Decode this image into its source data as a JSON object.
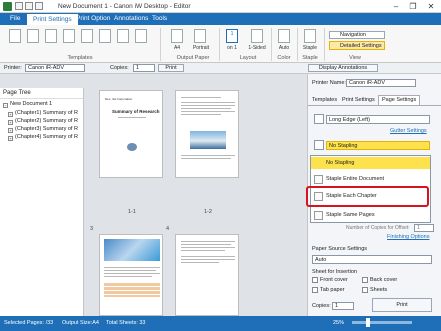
{
  "window": {
    "title": "New Document 1 - Canon iW Desktop - Editor",
    "controls": [
      "–",
      "❐",
      "✕"
    ]
  },
  "ribbon": {
    "tabs": [
      "File",
      "Print Settings",
      "Print Option",
      "Annotations",
      "Tools"
    ],
    "active_tab": "Print Settings",
    "groups": {
      "templates": "Templates",
      "output_paper": "Output Paper",
      "layout": "Layout",
      "color": "Color",
      "staple": "Staple",
      "view": "View"
    },
    "items": {
      "paper_size": "A4",
      "orientation": "Portrait",
      "pages_per_sheet_value": "1",
      "pages_per_sheet_sub": "on 1",
      "sided": "1-Sided",
      "color_mode": "Auto",
      "staple": "Staple",
      "navigation": "Navigation",
      "detailed_settings": "Detailed Settings"
    }
  },
  "toolbar2": {
    "printer_label": "Printer:",
    "printer_value": "Canon iR-ADV",
    "copies_label": "Copies:",
    "copies_value": "1",
    "print_label": "Print",
    "display_annotations": "Display Annotations"
  },
  "left_pane": {
    "title": "Page Tree",
    "items": [
      "New Document 1",
      "(Chapter1) Summary of R",
      "(Chapter2) Summary of R",
      "(Chapter3) Summary of R",
      "(Chapter4) Summary of R"
    ]
  },
  "preview": {
    "page_labels": [
      "1-1",
      "1-2",
      "3",
      "4"
    ],
    "page1_header": "Res. 4H Corporation",
    "page1_title": "Summary of Research"
  },
  "right_pane": {
    "printer_label": "Printer Name:",
    "printer_value": "Canon iR-ADV",
    "tabs": [
      "Templates",
      "Print Settings",
      "Page Settings"
    ],
    "active_tab": "Page Settings",
    "binding_value": "Long Edge (Left)",
    "gutter_link": "Gutter Settings",
    "staple_select_value": "No Stapling",
    "staple_options": [
      "No Stapling",
      "Staple Entire Document",
      "Staple Each Chapter",
      "Staple Same Pages"
    ],
    "highlighted_option": "Staple Each Chapter",
    "copies_offset_label": "Number of Copies for Offset:",
    "copies_offset_value": "1",
    "finishing_link": "Finishing Options",
    "paper_source_title": "Paper Source Settings",
    "paper_source_value": "Auto",
    "sheet_insertion_title": "Sheet for Insertion",
    "checkboxes": [
      "Front cover",
      "Back cover",
      "Tab paper",
      "Sheets"
    ],
    "copies_label": "Copies:",
    "copies_value": "1",
    "print_button": "Print"
  },
  "status": {
    "selected_pages": "Selected Pages: /33",
    "output_size": "Output Size:A4",
    "total_sheets": "Total Sheets: 33",
    "zoom": "25%"
  },
  "colors": {
    "accent": "#1e6fb8",
    "highlight_border": "#d9121f",
    "selected_option": "#fde24d"
  }
}
